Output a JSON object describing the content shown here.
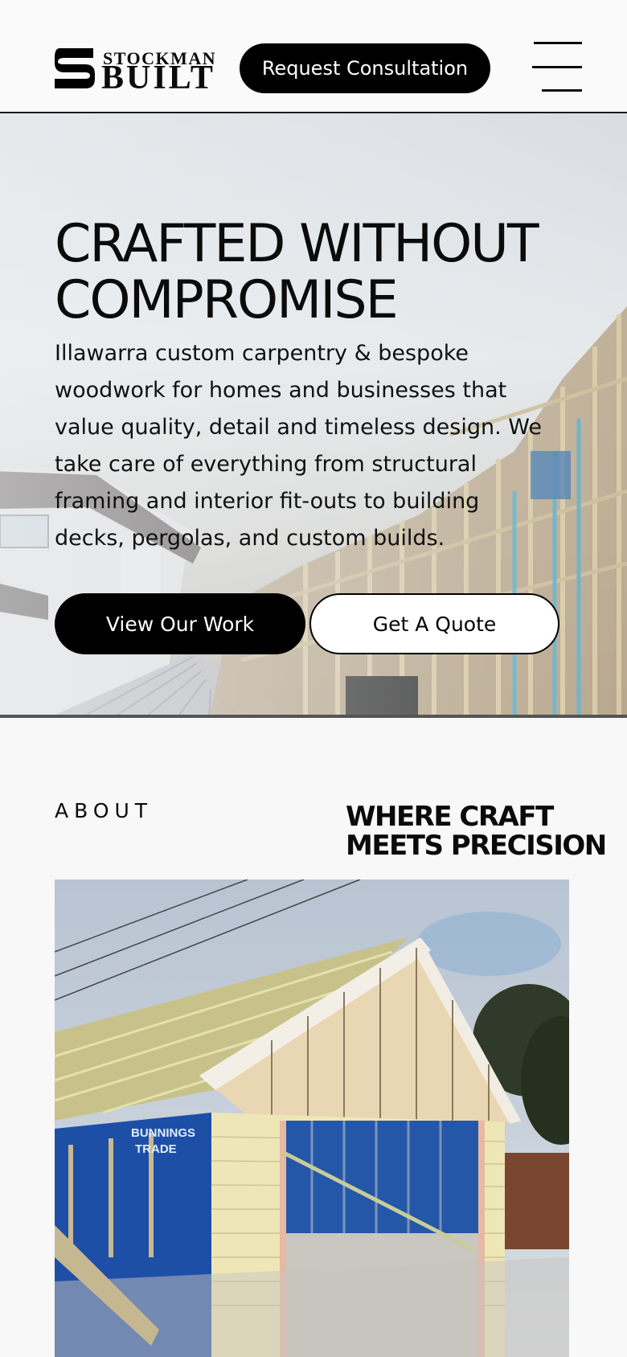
{
  "header": {
    "logo_top": "STOCKMAN",
    "logo_bottom": "BUILT",
    "cta_label": "Request Consultation",
    "menu_icon": "hamburger-menu-icon"
  },
  "hero": {
    "title": "CRAFTED WITHOUT\nCOMPROMISE",
    "description": "Illawarra custom carpentry & bespoke woodwork for homes and businesses that value quality, detail and timeless design. We take care of everything from structural framing and interior fit-outs to building decks, pergolas, and custom builds.",
    "primary_button": "View Our Work",
    "secondary_button": "Get A Quote"
  },
  "about": {
    "label": "ABOUT",
    "heading": "WHERE CRAFT\nMEETS PRECISION",
    "photo_signage": "BUNNINGS TRADE"
  },
  "colors": {
    "primary": "#000000",
    "background": "#f8f8f8",
    "text": "#0b0b0b"
  }
}
